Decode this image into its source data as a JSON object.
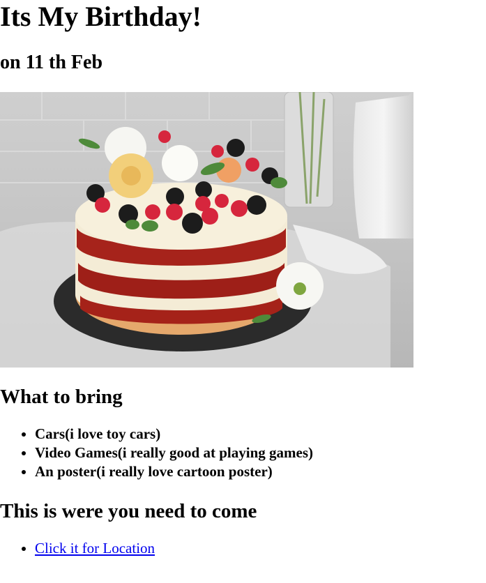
{
  "page": {
    "title": "Its My Birthday!",
    "subtitle": "on 11 th Feb"
  },
  "image": {
    "subject": "layered red velvet cake topped with berries and flowers"
  },
  "bring": {
    "heading": "What to bring",
    "items": [
      "Cars(i love toy cars)",
      "Video Games(i really good at playing games)",
      "An poster(i really love cartoon poster)"
    ]
  },
  "location": {
    "heading": "This is were you need to come",
    "link_text": "Click it for Location",
    "link_color": "#0000ee"
  }
}
